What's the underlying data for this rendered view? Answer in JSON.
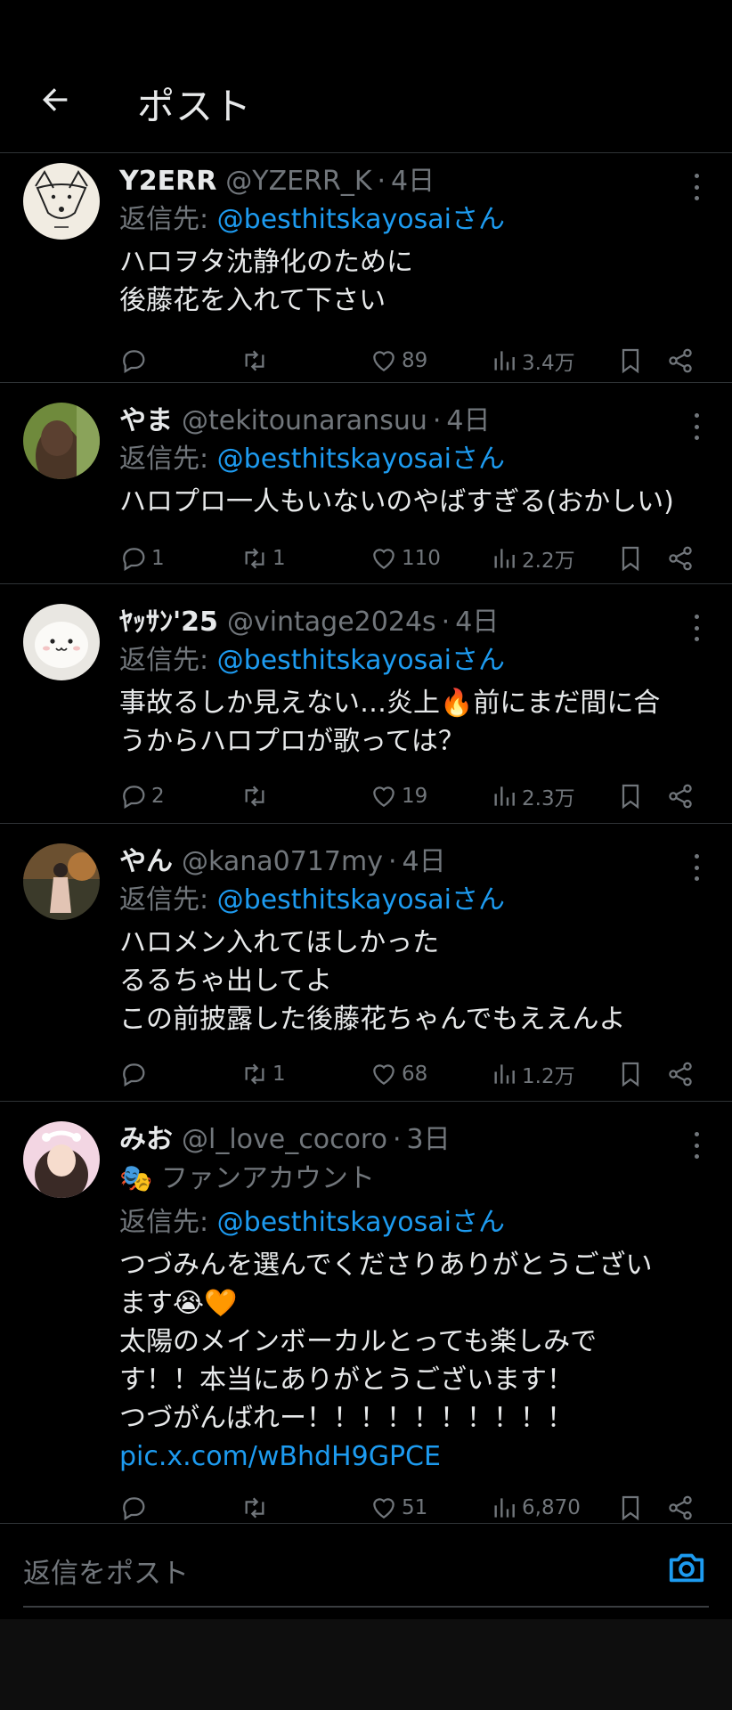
{
  "header": {
    "title": "ポスト"
  },
  "replying_label": "返信先:",
  "tweets": [
    {
      "name": "Y2ERR",
      "handle": "@YZERR_K",
      "time": "4日",
      "reply_to": "@besthitskayosaiさん",
      "text": "ハロヲタ沈静化のために\n後藤花を入れて下さい",
      "replies": "",
      "retweets": "",
      "likes": "89",
      "views": "3.4万"
    },
    {
      "name": "やま",
      "handle": "@tekitounaransuu",
      "time": "4日",
      "reply_to": "@besthitskayosaiさん",
      "text": "ハロプロ一人もいないのやばすぎる(おかしい)",
      "replies": "1",
      "retweets": "1",
      "likes": "110",
      "views": "2.2万"
    },
    {
      "name": "ﾔｯｻﾝ'25",
      "handle": "@vintage2024s",
      "time": "4日",
      "reply_to": "@besthitskayosaiさん",
      "text": "事故るしか見えない…炎上🔥前にまだ間に合\nうからハロプロが歌っては？",
      "replies": "2",
      "retweets": "",
      "likes": "19",
      "views": "2.3万"
    },
    {
      "name": "やん",
      "handle": "@kana0717my",
      "time": "4日",
      "reply_to": "@besthitskayosaiさん",
      "text": "ハロメン入れてほしかった\nるるちゃ出してよ\nこの前披露した後藤花ちゃんでもええんよ",
      "replies": "",
      "retweets": "1",
      "likes": "68",
      "views": "1.2万"
    },
    {
      "name": "みお",
      "handle": "@l_love_cocoro",
      "time": "3日",
      "badge": "ファンアカウント",
      "reply_to": "@besthitskayosaiさん",
      "text": "つづみんを選んでくださりありがとうござい\nます😭🧡\n太陽のメインボーカルとっても楽しみで\nす！！本当にありがとうございます！\nつづがんばれー！！！！！！！！！！",
      "link": "pic.x.com/wBhdH9GPCE",
      "replies": "",
      "retweets": "",
      "likes": "51",
      "views": "6,870"
    }
  ],
  "composer": {
    "placeholder": "返信をポスト"
  },
  "colors": {
    "background": "#000000",
    "accent": "#1d9bf0",
    "muted": "#71767b",
    "text": "#e7e9ea",
    "divider": "#2f3336"
  },
  "icons": [
    "back-arrow-icon",
    "more-icon",
    "reply-icon",
    "retweet-icon",
    "heart-icon",
    "views-icon",
    "bookmark-icon",
    "share-icon",
    "camera-icon",
    "theater-mask-icon"
  ]
}
